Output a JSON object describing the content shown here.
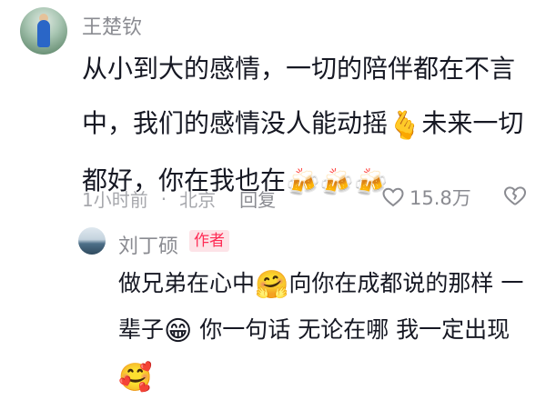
{
  "comment": {
    "author": "王楚钦",
    "text_part1": "从小到大的感情，一切的陪伴都在不言中，我们的感情没人能动摇",
    "emoji1": "🫰",
    "text_part2": "未来一切都好，你在我也在",
    "emoji_beer": "🍻",
    "time": "1小时前",
    "dot": "·",
    "location": "北京",
    "reply_label": "回复",
    "like_count": "15.8万",
    "icons": [
      "heart-icon",
      "broken-heart-icon"
    ]
  },
  "reply": {
    "author": "刘丁硕",
    "author_badge": "作者",
    "text_part1": "做兄弟在心中",
    "emoji_hug": "🤗",
    "text_part2": "向你在成都说的那样 一辈子",
    "emoji_grin": "😁",
    "text_part3": "你一句话 无论在哪 我一定出现",
    "emoji_smile": "🥰"
  }
}
